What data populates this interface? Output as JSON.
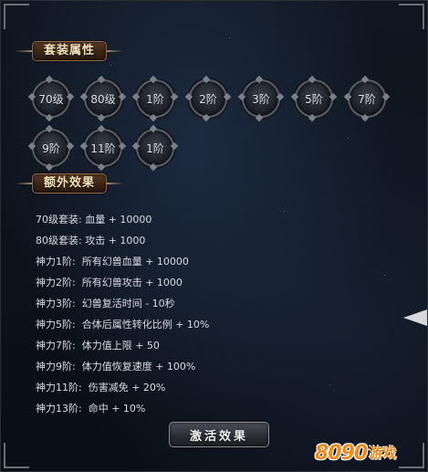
{
  "set_attributes": {
    "title": "套装属性",
    "badges_row1": [
      "70级",
      "80级",
      "1阶",
      "2阶",
      "3阶",
      "5阶",
      "7阶"
    ],
    "badges_row2": [
      "9阶",
      "11阶",
      "1阶"
    ]
  },
  "extra_effects": {
    "title": "额外效果",
    "rows": [
      "70级套装: 血量 + 10000",
      "80级套装: 攻击 + 1000",
      "神力1阶:  所有幻兽血量 + 10000",
      "神力2阶:  所有幻兽攻击 + 1000",
      "神力3阶:  幻兽复活时间 - 10秒",
      "神力5阶:  合体后属性转化比例 + 10%",
      "神力7阶:  体力值上限 + 50",
      "神力9阶:  体力值恢复速度 + 100%",
      "神力11阶:  伤害减免 + 20%",
      "神力13阶:  命中 + 10%"
    ]
  },
  "activate_button": {
    "label": "激活效果"
  },
  "watermark": {
    "number": "8090",
    "text": "游戏"
  },
  "colors": {
    "header_plate": "#3a2416",
    "header_text": "#f3e2b8",
    "effect_text": "#d8dce2",
    "logo_orange": "#f08a1a"
  }
}
